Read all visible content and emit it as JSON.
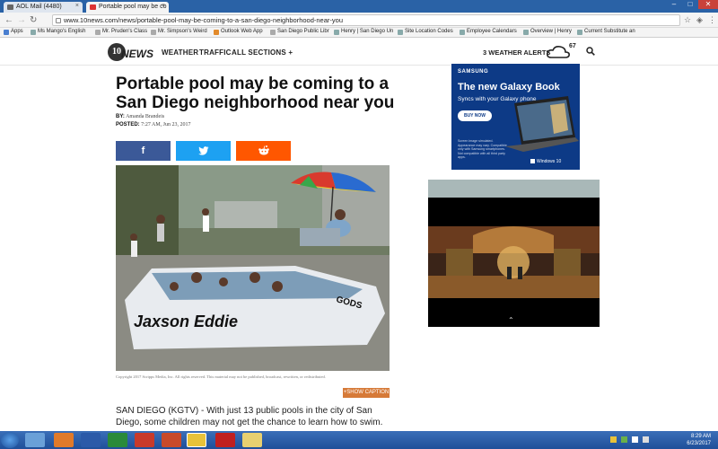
{
  "browser": {
    "tabs": [
      {
        "label": "AOL Mail (4480)"
      },
      {
        "label": "Portable pool may be co"
      }
    ],
    "url": "www.10news.com/news/portable-pool-may-be-coming-to-a-san-diego-neighborhood-near-you",
    "bookmarks": [
      "Apps",
      "Ms Mango's English",
      "Mr. Pruden's Class",
      "Mr. Simpson's Weird",
      "Outlook Web App",
      "San Diego Public Libr",
      "Henry | San Diego Un",
      "Site Location Codes",
      "Employee Calendars",
      "Overview | Henry",
      "Current Substitute an"
    ]
  },
  "site": {
    "logo_number": "10",
    "logo_text": "NEWS",
    "nav": [
      "WEATHER",
      "TRAFFIC",
      "ALL SECTIONS +"
    ],
    "weather_alerts": "3 WEATHER ALERTS",
    "temperature": "67"
  },
  "article": {
    "headline": "Portable pool may be coming to a San Diego neighborhood near you",
    "by_label": "BY:",
    "author": "Amanda Brandeis",
    "posted_label": "POSTED:",
    "posted": "7:27 AM, Jun 23, 2017",
    "share_buttons": [
      {
        "name": "facebook",
        "glyph": "f",
        "color": "#3b5998"
      },
      {
        "name": "twitter",
        "glyph": "t",
        "color": "#1da1f2"
      },
      {
        "name": "reddit",
        "glyph": "r",
        "color": "#ff5700"
      }
    ],
    "photo_boat_text_1": "Jaxson Eddie",
    "photo_boat_text_2": "GODS",
    "copyright": "Copyright 2017 Scripps Media, Inc. All rights reserved. This material may not be published, broadcast, rewritten, or redistributed.",
    "caption_button": "+SHOW CAPTION",
    "body": "SAN DIEGO (KGTV) - With just 13 public pools in the city of San Diego, some children may not get the chance to learn how to swim."
  },
  "ad": {
    "brand": "SAMSUNG",
    "title": "The new Galaxy Book",
    "subtitle": "Syncs with your Galaxy phone",
    "cta": "BUY NOW",
    "fine_print": "Screen image simulated. Appearance may vary. Compatible only with Samsung smartphones. Not compatible with all third party apps.",
    "windows": "Windows 10"
  },
  "taskbar": {
    "time": "8:29 AM",
    "date": "6/23/2017"
  },
  "colors": {
    "accent": "#d67a38",
    "taskbar": "#1f4f99",
    "ad_bg": "#0d3a86"
  }
}
